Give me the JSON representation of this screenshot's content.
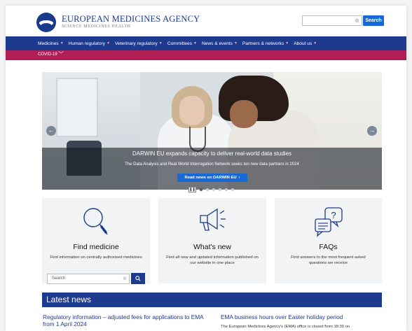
{
  "header": {
    "logo_title": "EUROPEAN MEDICINES AGENCY",
    "logo_subtitle": "SCIENCE MEDICINES HEALTH",
    "search_placeholder": "",
    "search_button": "Search"
  },
  "nav": {
    "items": [
      {
        "label": "Medicines"
      },
      {
        "label": "Human regulatory"
      },
      {
        "label": "Veterinary regulatory"
      },
      {
        "label": "Committees"
      },
      {
        "label": "News & events"
      },
      {
        "label": "Partners & networks"
      },
      {
        "label": "About us"
      }
    ]
  },
  "covid_bar": {
    "label": "COVID-19"
  },
  "hero": {
    "title": "DARWIN EU expands capacity to deliver real-world data studies",
    "subtitle": "The Data Analysis and Real World Interrogation Network seeks ten new data partners in 2024",
    "button": "Read news on DARWIN EU",
    "slide_count": 6,
    "active_slide": 1
  },
  "cards": [
    {
      "icon": "magnifier-icon",
      "title": "Find medicine",
      "description": "Find information on centrally authorised medicines",
      "search_placeholder": "Search"
    },
    {
      "icon": "megaphone-icon",
      "title": "What's new",
      "description": "Find all new and updated information published on our website in one place"
    },
    {
      "icon": "faq-bubbles-icon",
      "title": "FAQs",
      "description": "Find answers to the most frequent asked questions we receive"
    }
  ],
  "latest_news": {
    "heading": "Latest news",
    "items": [
      {
        "title": "Regulatory information – adjusted fees for applications to EMA from 1 April 2024"
      },
      {
        "title": "EMA business hours over Easter holiday period",
        "text": "The European Medicines Agency's (EMA) office is closed from 18:30 on"
      }
    ]
  },
  "colors": {
    "nav_blue": "#1e3a8f",
    "accent_blue": "#1769d6",
    "covid_magenta": "#b01e54"
  }
}
